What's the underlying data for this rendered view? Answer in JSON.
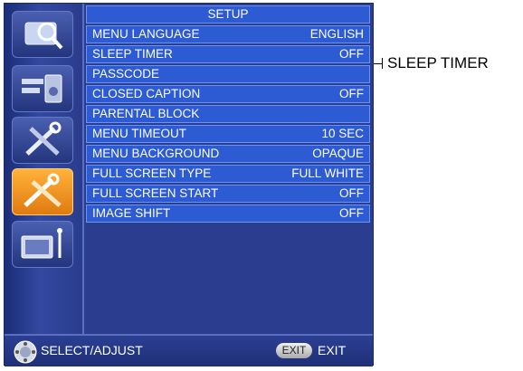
{
  "menu": {
    "title": "SETUP",
    "items": [
      {
        "label": "MENU LANGUAGE",
        "value": "ENGLISH"
      },
      {
        "label": "SLEEP TIMER",
        "value": "OFF"
      },
      {
        "label": "PASSCODE",
        "value": ""
      },
      {
        "label": "CLOSED CAPTION",
        "value": "OFF"
      },
      {
        "label": "PARENTAL BLOCK",
        "value": ""
      },
      {
        "label": "MENU TIMEOUT",
        "value": "10 SEC"
      },
      {
        "label": "MENU BACKGROUND",
        "value": "OPAQUE"
      },
      {
        "label": "FULL SCREEN TYPE",
        "value": "FULL WHITE"
      },
      {
        "label": "FULL SCREEN START",
        "value": "OFF"
      },
      {
        "label": "IMAGE SHIFT",
        "value": "OFF"
      }
    ]
  },
  "sidebar": {
    "icons": [
      "picture-magnifier-icon",
      "audio-speaker-icon",
      "tools-icon",
      "setup-tools-icon",
      "monitor-antenna-icon"
    ],
    "active_index": 3
  },
  "footer": {
    "hint": "SELECT/ADJUST",
    "exit_button": "EXIT",
    "exit_label": "EXIT"
  },
  "callout": {
    "label": "SLEEP TIMER"
  },
  "colors": {
    "background": "#2a3d8f",
    "row": "#2d5bd3",
    "active_icon": "#f39a22"
  }
}
